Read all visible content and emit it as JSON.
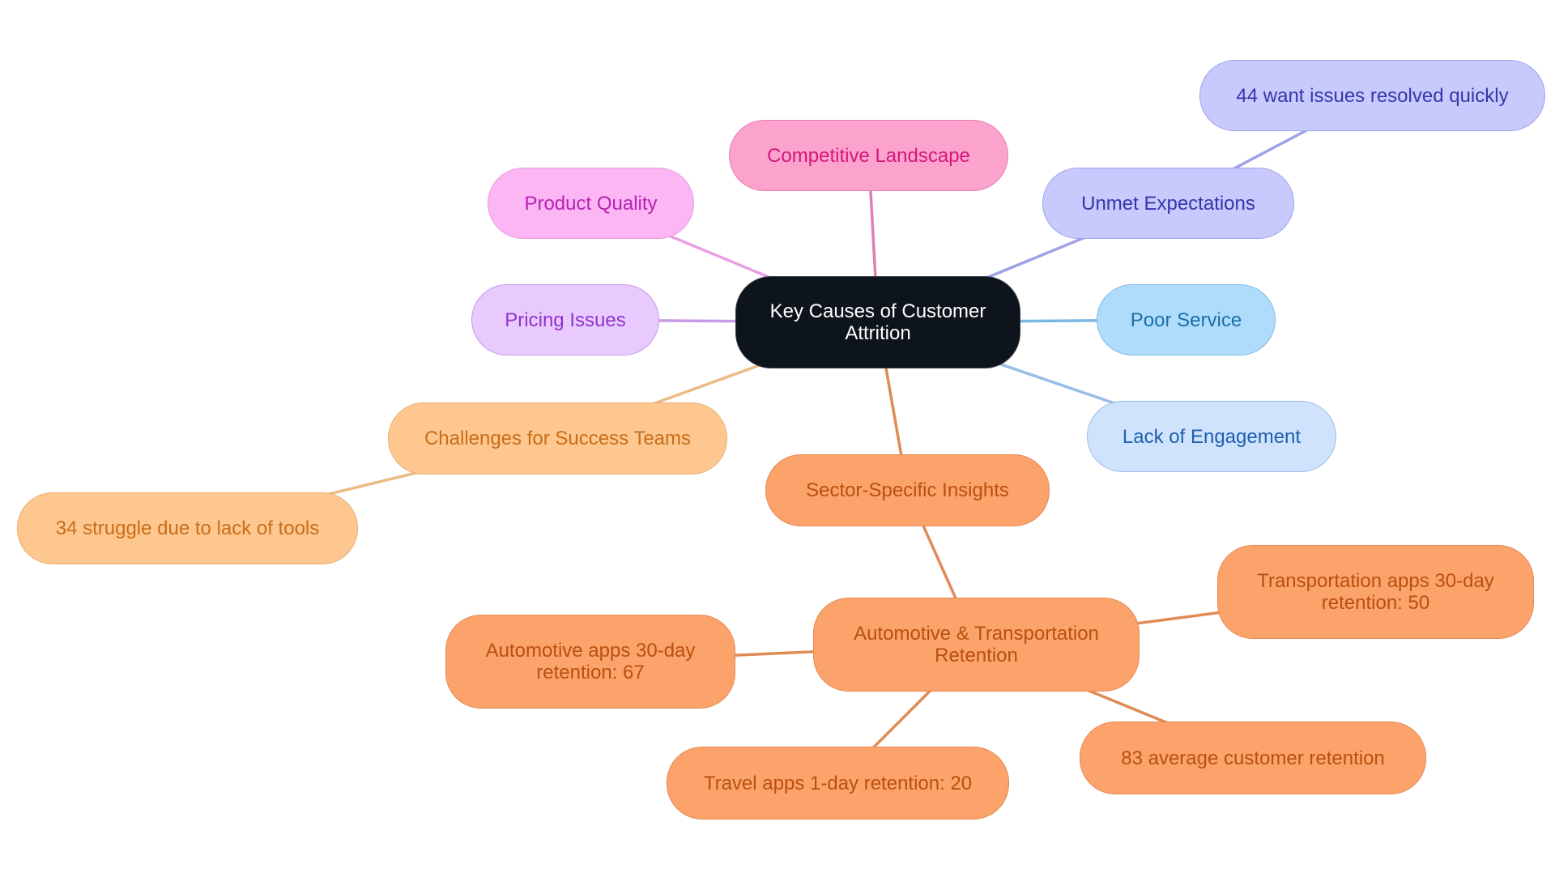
{
  "diagram": {
    "type": "mindmap",
    "root": {
      "id": "root",
      "label": "Key Causes of Customer Attrition",
      "fill": "#0d141c",
      "stroke": "#3a3f46",
      "text_color": "#ffffff"
    },
    "nodes": [
      {
        "id": "competitive",
        "label": "Competitive Landscape",
        "parent": "root",
        "fill": "#fca3cd",
        "stroke": "#e87bb0",
        "text_color": "#d3177a",
        "edge_color": "#e07fb4"
      },
      {
        "id": "product",
        "label": "Product Quality",
        "parent": "root",
        "fill": "#fcb6f4",
        "stroke": "#e49be0",
        "text_color": "#b623b5",
        "edge_color": "#e9a0e3"
      },
      {
        "id": "pricing",
        "label": "Pricing Issues",
        "parent": "root",
        "fill": "#e9caff",
        "stroke": "#c79aea",
        "text_color": "#9134c9",
        "edge_color": "#c99ae8"
      },
      {
        "id": "unmet",
        "label": "Unmet Expectations",
        "parent": "root",
        "fill": "#c8cafd",
        "stroke": "#9ea2ee",
        "text_color": "#3437a8",
        "edge_color": "#9ea2e6"
      },
      {
        "id": "quick",
        "label": "44 want issues resolved quickly",
        "parent": "unmet",
        "fill": "#c8cafd",
        "stroke": "#9ea2ee",
        "text_color": "#3437a8",
        "edge_color": "#9ea2e6"
      },
      {
        "id": "poor",
        "label": "Poor Service",
        "parent": "root",
        "fill": "#b0dcfc",
        "stroke": "#7dbbe6",
        "text_color": "#1c6fa6",
        "edge_color": "#7ab8e3"
      },
      {
        "id": "engagement",
        "label": "Lack of Engagement",
        "parent": "root",
        "fill": "#cfe3fc",
        "stroke": "#98bde8",
        "text_color": "#1f5fb0",
        "edge_color": "#98bde8"
      },
      {
        "id": "challenges",
        "label": "Challenges for Success Teams",
        "parent": "root",
        "fill": "#fdc78f",
        "stroke": "#ebb077",
        "text_color": "#c96d19",
        "edge_color": "#ecbb83"
      },
      {
        "id": "tools",
        "label": "34 struggle due to lack of tools",
        "parent": "challenges",
        "fill": "#fdc78f",
        "stroke": "#ebb077",
        "text_color": "#c96d19",
        "edge_color": "#ecbb83"
      },
      {
        "id": "sector",
        "label": "Sector-Specific Insights",
        "parent": "root",
        "fill": "#fca36c",
        "stroke": "#e48a55",
        "text_color": "#b8500e",
        "edge_color": "#e08a55"
      },
      {
        "id": "autotrans",
        "label": "Automotive & Transportation\nRetention",
        "parent": "sector",
        "fill": "#fca36c",
        "stroke": "#e48a55",
        "text_color": "#b8500e",
        "edge_color": "#e08a55"
      },
      {
        "id": "transport30",
        "label": "Transportation apps 30-day\nretention: 50",
        "parent": "autotrans",
        "fill": "#fca36c",
        "stroke": "#e48a55",
        "text_color": "#b8500e",
        "edge_color": "#e08a55"
      },
      {
        "id": "auto30",
        "label": "Automotive apps 30-day\nretention: 67",
        "parent": "autotrans",
        "fill": "#fca36c",
        "stroke": "#e48a55",
        "text_color": "#b8500e",
        "edge_color": "#e08a55"
      },
      {
        "id": "travel1",
        "label": "Travel apps 1-day retention: 20",
        "parent": "autotrans",
        "fill": "#fca36c",
        "stroke": "#e48a55",
        "text_color": "#b8500e",
        "edge_color": "#e08a55"
      },
      {
        "id": "avg83",
        "label": "83 average customer retention",
        "parent": "autotrans",
        "fill": "#fca36c",
        "stroke": "#e48a55",
        "text_color": "#b8500e",
        "edge_color": "#e08a55"
      }
    ]
  }
}
